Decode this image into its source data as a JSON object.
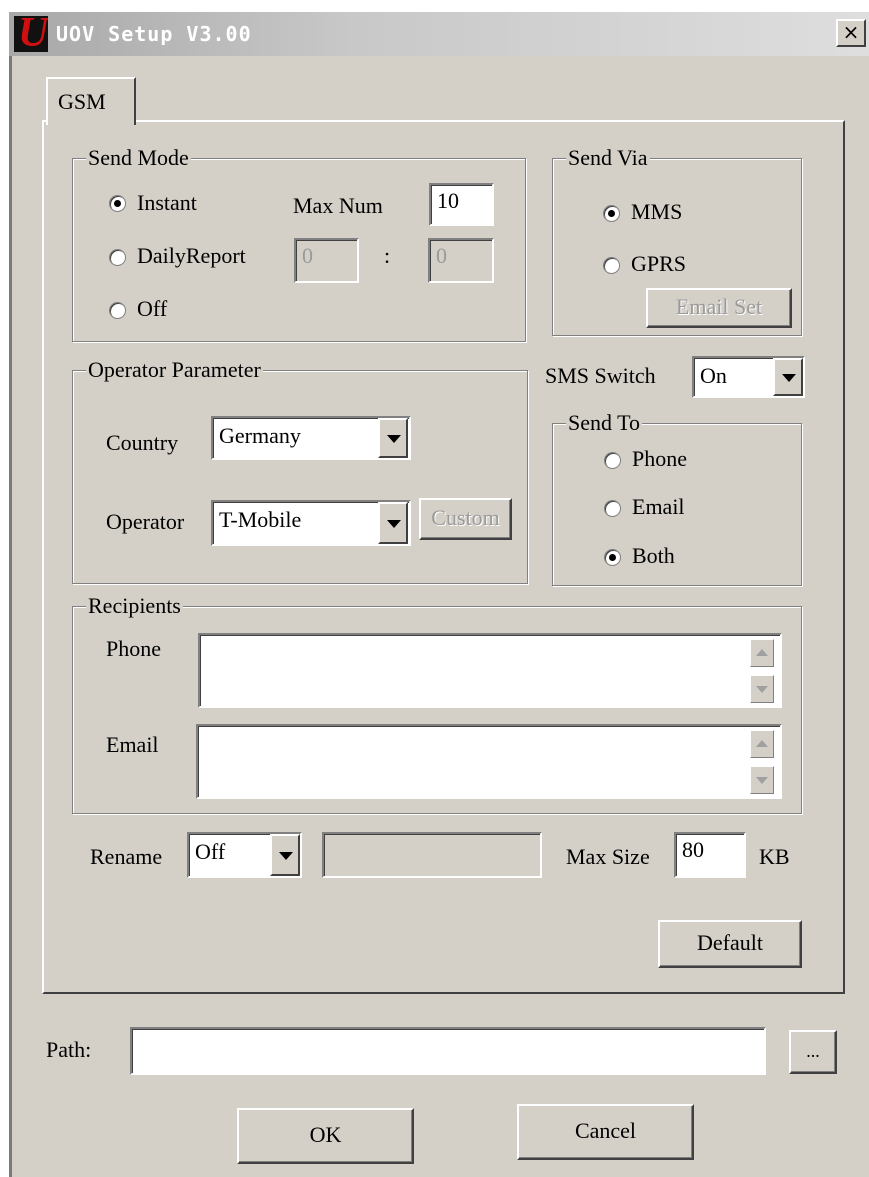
{
  "window": {
    "title": "UOV Setup V3.00",
    "logo_letter": "U",
    "close_label": "×"
  },
  "tabs": [
    {
      "label": "GSM"
    }
  ],
  "send_mode": {
    "legend": "Send Mode",
    "options": [
      "Instant",
      "DailyReport",
      "Off"
    ],
    "selected": "Instant",
    "max_num_label": "Max Num",
    "max_num_value": "10",
    "daily_hour": "0",
    "separator": ":",
    "daily_minute": "0"
  },
  "send_via": {
    "legend": "Send Via",
    "options": [
      "MMS",
      "GPRS"
    ],
    "selected": "MMS",
    "email_set_label": "Email Set"
  },
  "sms_switch": {
    "label": "SMS Switch",
    "value": "On"
  },
  "operator": {
    "legend": "Operator Parameter",
    "country_label": "Country",
    "country_value": "Germany",
    "operator_label": "Operator",
    "operator_value": "T-Mobile",
    "custom_label": "Custom"
  },
  "send_to": {
    "legend": "Send To",
    "options": [
      "Phone",
      "Email",
      "Both"
    ],
    "selected": "Both"
  },
  "recipients": {
    "legend": "Recipients",
    "phone_label": "Phone",
    "phone_value": "",
    "email_label": "Email",
    "email_value": ""
  },
  "rename": {
    "label": "Rename",
    "value": "Off",
    "text": ""
  },
  "max_size": {
    "label": "Max Size",
    "value": "80",
    "unit": "KB"
  },
  "default_label": "Default",
  "path": {
    "label": "Path:",
    "value": "",
    "browse_label": "..."
  },
  "footer": {
    "ok_label": "OK",
    "cancel_label": "Cancel"
  }
}
